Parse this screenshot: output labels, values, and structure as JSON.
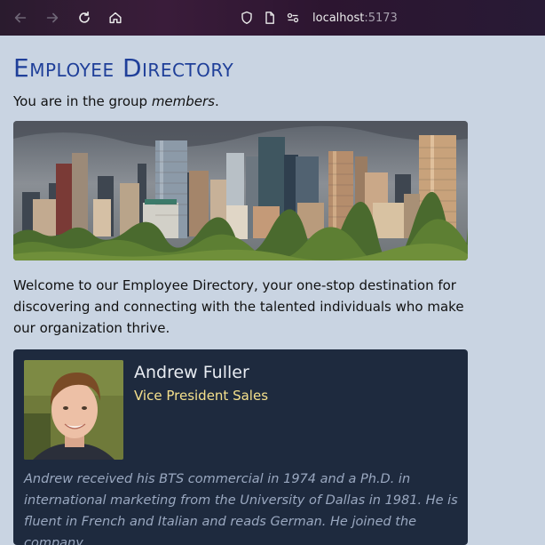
{
  "browser": {
    "url_host": "localhost",
    "url_port": ":5173",
    "icons": [
      "back-arrow-icon",
      "forward-arrow-icon",
      "reload-icon",
      "home-icon",
      "shield-icon",
      "page-icon",
      "permissions-icon"
    ]
  },
  "page": {
    "title": "Employee Directory",
    "group_prefix": "You are in the group ",
    "group_name": "members",
    "group_suffix": ".",
    "welcome": "Welcome to our Employee Directory, your one-stop destination for discovering and connecting with the talented individuals who make our organization thrive."
  },
  "employee": {
    "name": "Andrew Fuller",
    "title": "Vice President Sales",
    "bio": "Andrew received his BTS commercial in 1974 and a Ph.D. in international marketing from the University of Dallas in 1981. He is fluent in French and Italian and reads German. He joined the company"
  },
  "colors": {
    "page_bg": "#c9d4e2",
    "title": "#1f3f99",
    "card_bg": "#1e2a3e",
    "job_title": "#f5e08c",
    "bio_text": "#9aa8c0"
  }
}
